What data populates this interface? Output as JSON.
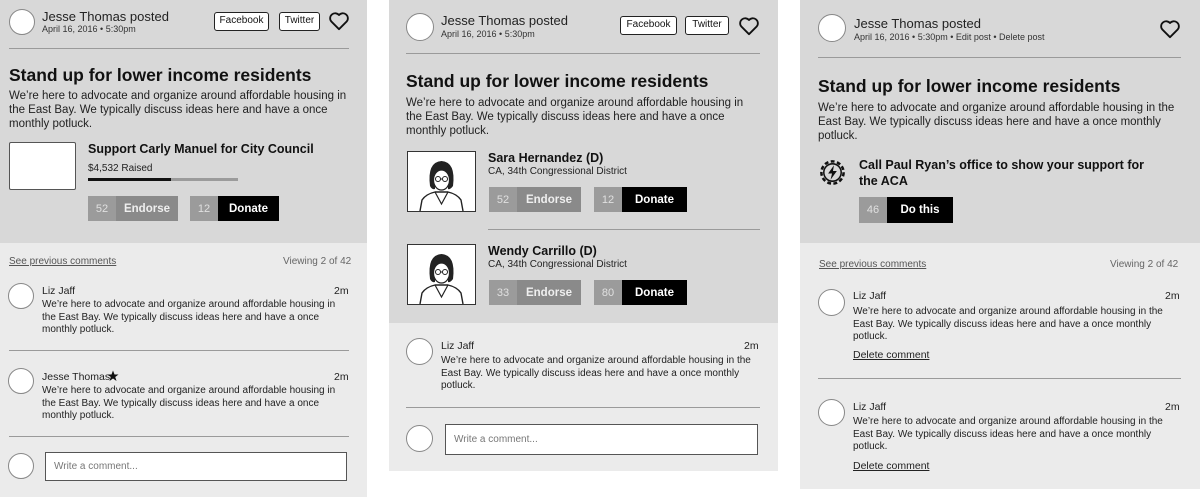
{
  "post": {
    "author": "Jesse Thomas posted",
    "date": "April 16, 2016 • 5:30pm",
    "date_owner": "April 16, 2016 • 5:30pm • Edit post • Delete post",
    "facebook": "Facebook",
    "twitter": "Twitter",
    "title": "Stand up for lower income residents",
    "description": "We’re here to advocate and organize around affordable housing in the East Bay. We typically discuss ideas here and have a once monthly potluck."
  },
  "panel1": {
    "campaign_title": "Support Carly Manuel for City Council",
    "raised": "$4,532 Raised",
    "raised_fraction": 0.55,
    "endorse_count": "52",
    "endorse_label": "Endorse",
    "donate_count": "12",
    "donate_label": "Donate",
    "see_previous": "See previous comments",
    "viewing": "Viewing 2 of 42",
    "comments": [
      {
        "name": "Liz Jaff",
        "time": "2m",
        "text": "We’re here to advocate and organize around affordable housing in the East Bay. We typically discuss ideas here and have a once monthly potluck."
      },
      {
        "name": "Jesse Thomas",
        "time": "2m",
        "text": "We’re here to advocate and organize around affordable housing in the East Bay. We typically discuss ideas here and have a once monthly potluck."
      }
    ],
    "input_placeholder": "Write a comment..."
  },
  "panel2": {
    "candidates": [
      {
        "name": "Sara Hernandez (D)",
        "district": "CA, 34th Congressional District",
        "endorse_count": "52",
        "endorse_label": "Endorse",
        "donate_count": "12",
        "donate_label": "Donate"
      },
      {
        "name": "Wendy Carrillo (D)",
        "district": "CA, 34th Congressional District",
        "endorse_count": "33",
        "endorse_label": "Endorse",
        "donate_count": "80",
        "donate_label": "Donate"
      }
    ],
    "comments": [
      {
        "name": "Liz Jaff",
        "time": "2m",
        "text": "We’re here to advocate and organize around affordable housing in the East Bay. We typically discuss ideas here and have a once monthly potluck."
      }
    ],
    "input_placeholder": "Write a comment..."
  },
  "panel3": {
    "action_title": "Call Paul Ryan’s office to show your support for the ACA",
    "action_count": "46",
    "action_label": "Do this",
    "see_previous": "See previous comments",
    "viewing": "Viewing 2 of 42",
    "comments": [
      {
        "name": "Liz Jaff",
        "time": "2m",
        "text": "We’re here to advocate and organize around affordable housing in the East Bay. We typically discuss ideas here and have a once monthly potluck.",
        "delete": "Delete comment"
      },
      {
        "name": "Liz Jaff",
        "time": "2m",
        "text": "We’re here to advocate and organize around affordable housing in the East Bay. We typically discuss ideas here and have a once monthly potluck.",
        "delete": "Delete comment"
      }
    ]
  },
  "icons": [
    "heart-icon",
    "lightning-gear-icon",
    "candidate-portrait-icon",
    "star-icon"
  ]
}
